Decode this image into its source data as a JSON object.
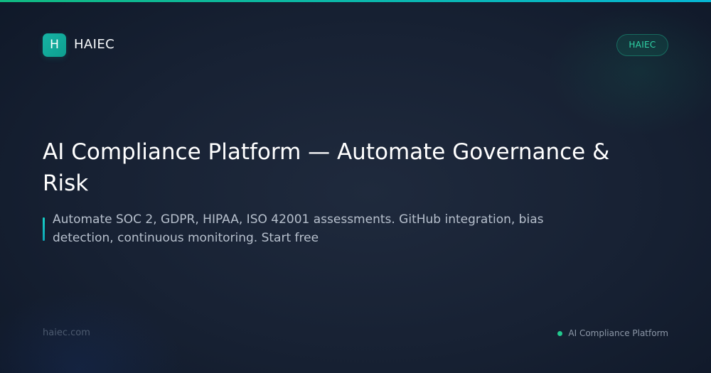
{
  "brand": {
    "logo_letter": "H",
    "name": "HAIEC",
    "badge": "HAIEC"
  },
  "hero": {
    "title": "AI Compliance Platform — Automate Governance & Risk",
    "description": "Automate SOC 2, GDPR, HIPAA, ISO 42001 assessments. GitHub integration, bias detection, continuous monitoring. Start free"
  },
  "footer": {
    "domain": "haiec.com",
    "label": "AI Compliance Platform"
  },
  "colors": {
    "background": "#172133",
    "accent_teal": "#14b8a6",
    "accent_green": "#22c98e",
    "top_bar_start": "#10b981",
    "top_bar_end": "#06b6d4"
  }
}
